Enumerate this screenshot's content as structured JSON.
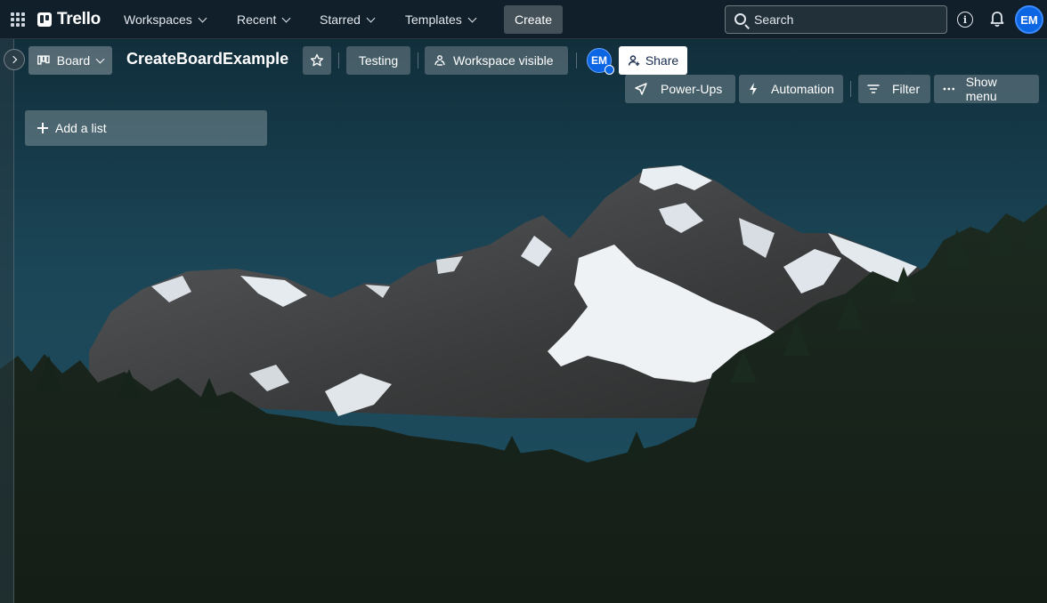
{
  "topnav": {
    "logo_text": "Trello",
    "items": [
      {
        "label": "Workspaces"
      },
      {
        "label": "Recent"
      },
      {
        "label": "Starred"
      },
      {
        "label": "Templates"
      }
    ],
    "create_label": "Create",
    "search_placeholder": "Search",
    "avatar_initials": "EM",
    "icons": [
      "apps-grid-icon",
      "trello-logo-icon",
      "search-icon",
      "info-icon",
      "bell-icon"
    ]
  },
  "board_header": {
    "view_label": "Board",
    "title": "CreateBoardExample",
    "workspace_label": "Testing",
    "visibility_label": "Workspace visible",
    "member_initials": "EM",
    "share_label": "Share",
    "powerups_label": "Power-Ups",
    "automation_label": "Automation",
    "filter_label": "Filter",
    "menu_label": "Show menu"
  },
  "lists": {
    "add_list_label": "Add a list"
  },
  "colors": {
    "accent_blue": "#0c66e4",
    "nav_bg": "#101e28",
    "sky": "#1d4b5c"
  }
}
